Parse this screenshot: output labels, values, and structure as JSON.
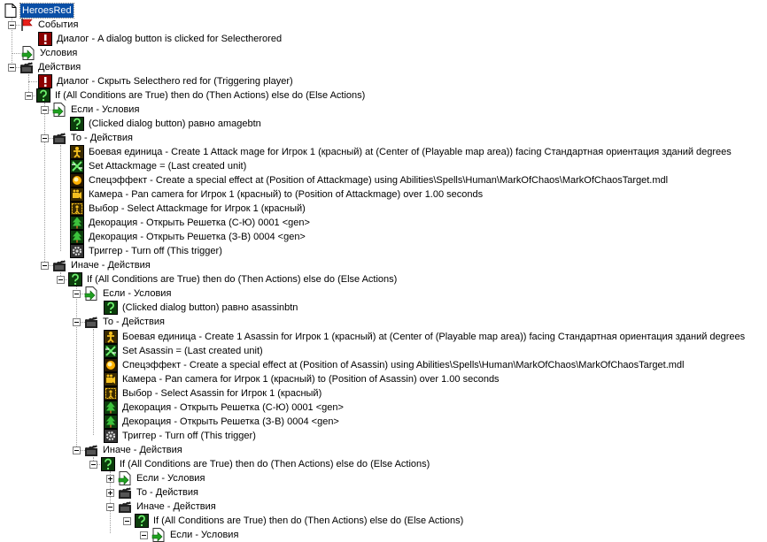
{
  "tree": {
    "root": {
      "label": "HeroesRed"
    },
    "events": {
      "label": "События",
      "items": [
        "Диалог - A dialog button is clicked for Selectherored"
      ]
    },
    "conditions": {
      "label": "Условия"
    },
    "actions": {
      "label": "Действия",
      "hide_dialog": "Диалог - Скрыть Selecthero red for (Triggering player)",
      "if_outer": "If (All Conditions are True) then do (Then Actions) else do (Else Actions)",
      "if1_conditions": "Если - Условия",
      "if1_cond_1": "(Clicked dialog button) равно amagebtn",
      "if1_then": "То - Действия",
      "if1_then_items": [
        "Боевая единица - Create 1 Attack mage for Игрок 1 (красный) at (Center of (Playable map area)) facing Стандартная ориентация зданий degrees",
        "Set Attackmage = (Last created unit)",
        "Спецэффект - Create a special effect at (Position of Attackmage) using Abilities\\Spells\\Human\\MarkOfChaos\\MarkOfChaosTarget.mdl",
        "Камера - Pan camera for Игрок 1 (красный) to (Position of Attackmage) over 1.00 seconds",
        "Выбор - Select Attackmage for Игрок 1 (красный)",
        "Декорация - Открыть Решетка (С-Ю) 0001 <gen>",
        "Декорация - Открыть Решетка (З-В) 0004 <gen>",
        "Триггер - Turn off (This trigger)"
      ],
      "if1_else": "Иначе - Действия",
      "if2": "If (All Conditions are True) then do (Then Actions) else do (Else Actions)",
      "if2_conditions": "Если - Условия",
      "if2_cond_1": "(Clicked dialog button) равно asassinbtn",
      "if2_then": "То - Действия",
      "if2_then_items": [
        "Боевая единица - Create 1 Asassin for Игрок 1 (красный) at (Center of (Playable map area)) facing Стандартная ориентация зданий degrees",
        "Set Asassin = (Last created unit)",
        "Спецэффект - Create a special effect at (Position of Asassin) using Abilities\\Spells\\Human\\MarkOfChaos\\MarkOfChaosTarget.mdl",
        "Камера - Pan camera for Игрок 1 (красный) to (Position of Asassin) over 1.00 seconds",
        "Выбор - Select Asassin for Игрок 1 (красный)",
        "Декорация - Открыть Решетка (С-Ю) 0001 <gen>",
        "Декорация - Открыть Решетка (З-В) 0004 <gen>",
        "Триггер - Turn off (This trigger)"
      ],
      "if2_else": "Иначе - Действия",
      "if3": "If (All Conditions are True) then do (Then Actions) else do (Else Actions)",
      "if3_conditions": "Если - Условия",
      "if3_then": "То - Действия",
      "if3_else": "Иначе - Действия",
      "if4": "If (All Conditions are True) then do (Then Actions) else do (Else Actions)",
      "if4_conditions": "Если - Условия"
    }
  },
  "colors": {
    "selection": "#0a4fa6",
    "dotted_line": "#a0a0a0"
  }
}
